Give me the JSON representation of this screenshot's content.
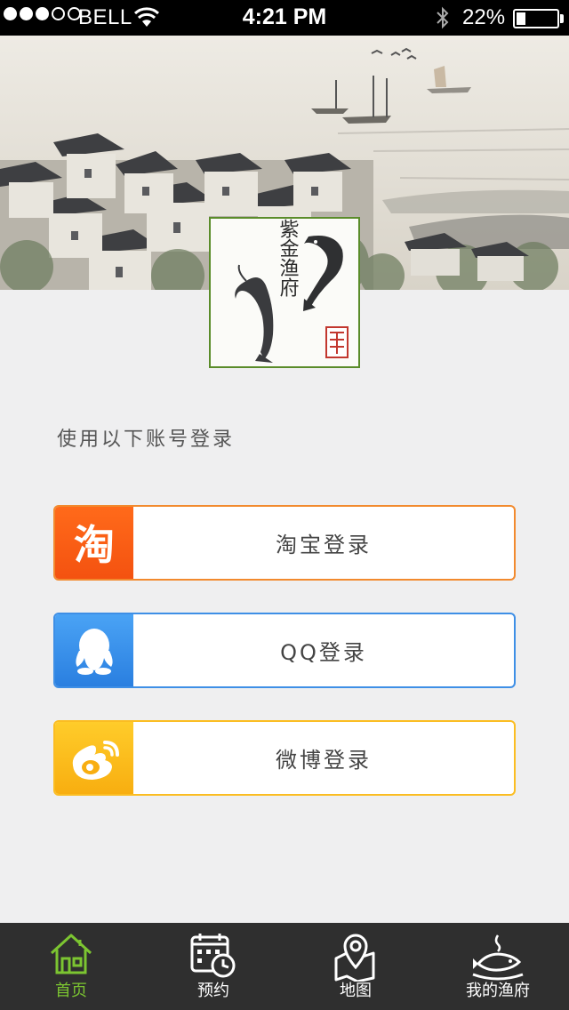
{
  "status_bar": {
    "carrier": "BELL",
    "time": "4:21 PM",
    "battery": "22%",
    "battery_level": 0.22
  },
  "logo": {
    "text": "紫金渔府"
  },
  "prompt": "使用以下账号登录",
  "login_buttons": [
    {
      "label": "淘宝登录",
      "icon": "taobao-icon",
      "color": "#f45210"
    },
    {
      "label": "QQ登录",
      "icon": "qq-icon",
      "color": "#2a7fe0"
    },
    {
      "label": "微博登录",
      "icon": "weibo-icon",
      "color": "#f8ae10"
    }
  ],
  "tabs": [
    {
      "label": "首页",
      "icon": "home-icon",
      "active": true
    },
    {
      "label": "预约",
      "icon": "calendar-clock-icon",
      "active": false
    },
    {
      "label": "地图",
      "icon": "map-pin-icon",
      "active": false
    },
    {
      "label": "我的渔府",
      "icon": "fish-dish-icon",
      "active": false
    }
  ],
  "colors": {
    "active_tab": "#7cc531",
    "tabbar_bg": "#2f2f2f"
  }
}
